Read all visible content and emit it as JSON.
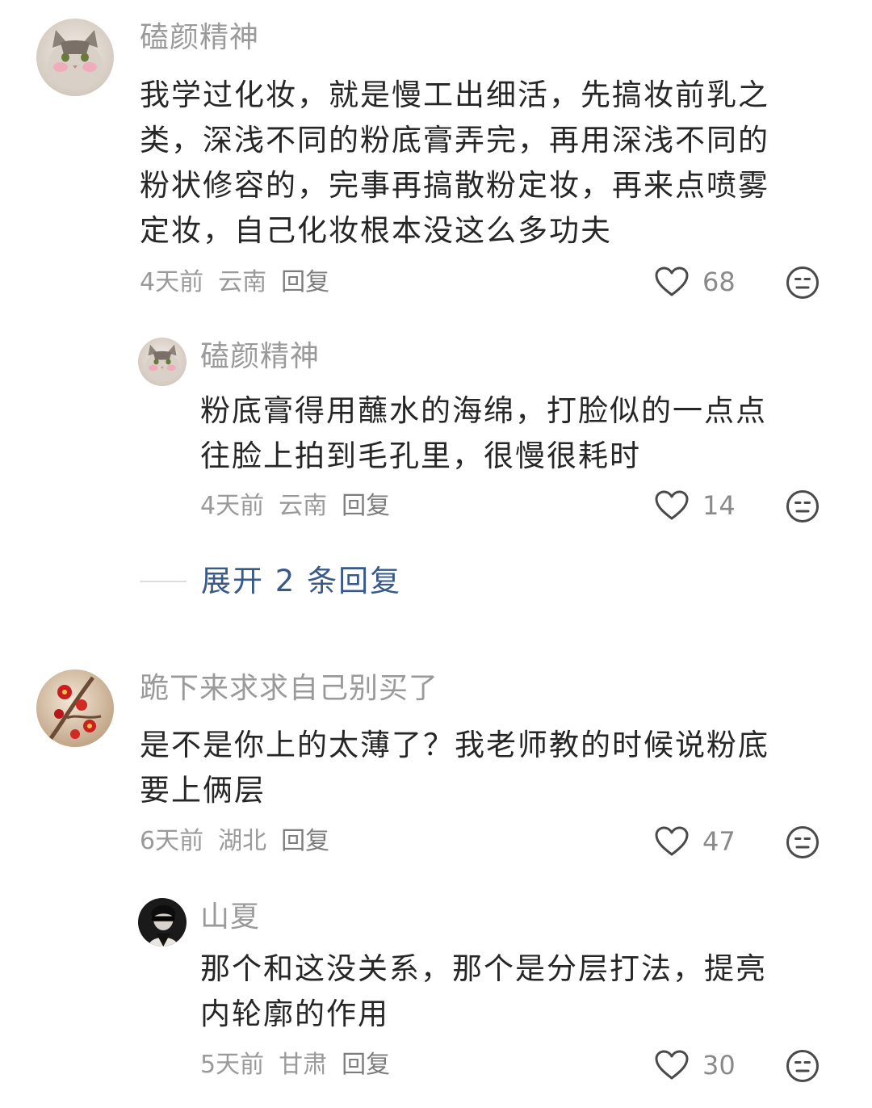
{
  "comments": [
    {
      "username": "磕颜精神",
      "avatar": "cat-avatar",
      "text_lines": [
        "我学过化妆，就是慢工出细活，先搞妆前乳之",
        "类，深浅不同的粉底膏弄完，再用深浅不同的",
        "粉状修容的，完事再搞散粉定妆，再来点喷雾",
        "定妆，自己化妆根本没这么多功夫"
      ],
      "time": "4天前",
      "location": "云南",
      "reply_label": "回复",
      "likes": "68",
      "replies": [
        {
          "username": "磕颜精神",
          "avatar": "cat-avatar",
          "text_lines": [
            "粉底膏得用蘸水的海绵，打脸似的一点点",
            "往脸上拍到毛孔里，很慢很耗时"
          ],
          "time": "4天前",
          "location": "云南",
          "reply_label": "回复",
          "likes": "14"
        }
      ],
      "expand_label": "展开 2 条回复"
    },
    {
      "username": "跪下来求求自己别买了",
      "avatar": "plum-blossom-avatar",
      "text_lines": [
        "是不是你上的太薄了？我老师教的时候说粉底",
        "要上俩层"
      ],
      "time": "6天前",
      "location": "湖北",
      "reply_label": "回复",
      "likes": "47",
      "replies": [
        {
          "username": "山夏",
          "avatar": "dark-portrait-avatar",
          "text_lines": [
            "那个和这没关系，那个是分层打法，提亮",
            "内轮廓的作用"
          ],
          "time": "5天前",
          "location": "甘肃",
          "reply_label": "回复",
          "likes": "30"
        }
      ]
    }
  ]
}
